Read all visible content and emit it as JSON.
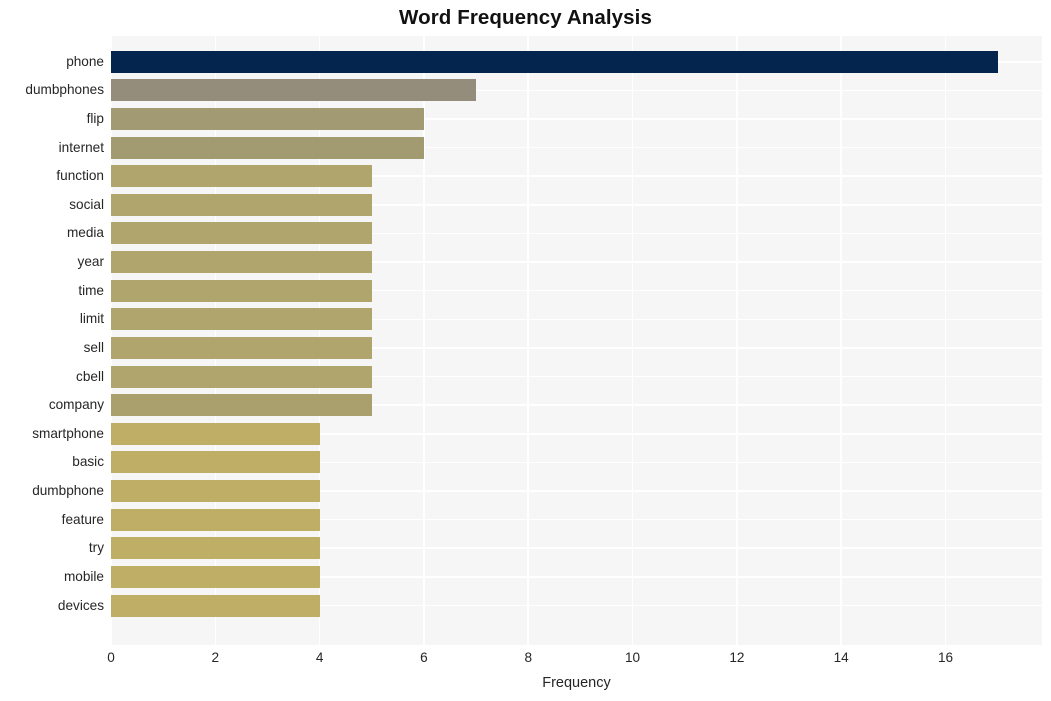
{
  "chart_data": {
    "type": "bar",
    "orientation": "horizontal",
    "title": "Word Frequency Analysis",
    "xlabel": "Frequency",
    "ylabel": "",
    "categories": [
      "phone",
      "dumbphones",
      "flip",
      "internet",
      "function",
      "social",
      "media",
      "year",
      "time",
      "limit",
      "sell",
      "cbell",
      "company",
      "smartphone",
      "basic",
      "dumbphone",
      "feature",
      "try",
      "mobile",
      "devices"
    ],
    "values": [
      17,
      7,
      6,
      6,
      5,
      5,
      5,
      5,
      5,
      5,
      5,
      5,
      5,
      4,
      4,
      4,
      4,
      4,
      4,
      4
    ],
    "bar_colors": [
      "#04254e",
      "#948d7c",
      "#a29a72",
      "#a29a71",
      "#b0a56c",
      "#b0a56c",
      "#b0a56c",
      "#b0a56c",
      "#b0a56c",
      "#b0a56c",
      "#b0a56c",
      "#b0a56c",
      "#a9a06e",
      "#bfae65",
      "#bfae65",
      "#bfae65",
      "#bfae65",
      "#bfae65",
      "#bfae65",
      "#bfae65"
    ],
    "xlim": [
      0,
      17.85
    ],
    "xticks": [
      0,
      2,
      4,
      6,
      8,
      10,
      12,
      14,
      16
    ],
    "xtick_labels": [
      "0",
      "2",
      "4",
      "6",
      "8",
      "10",
      "12",
      "14",
      "16"
    ],
    "grid": true,
    "grid_color": "#ffffff",
    "plot_background": "#f6f6f6",
    "figure_background": "#ffffff",
    "legend": null
  }
}
